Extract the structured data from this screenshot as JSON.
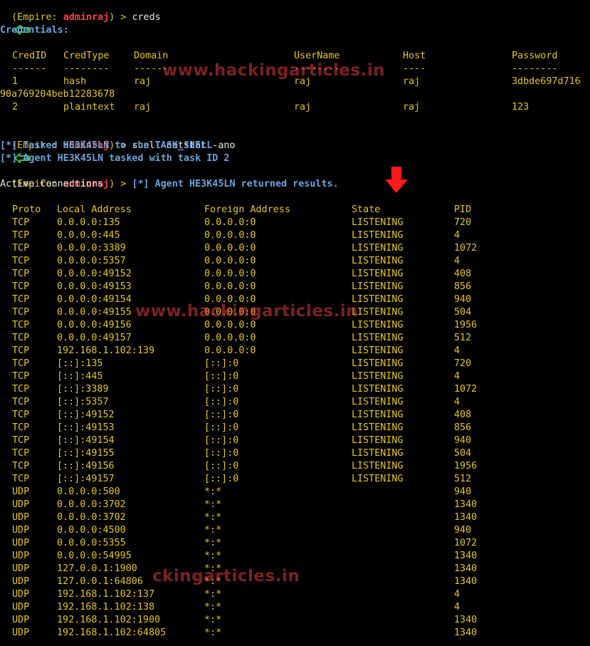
{
  "prompt": {
    "open": "(Empire: ",
    "user": "adminraj",
    "close": ") > "
  },
  "commands": {
    "creds": "creds",
    "shell": "shell netstat -ano"
  },
  "credentials": {
    "title": "Credentials:",
    "headers": [
      "CredID",
      "CredType",
      "Domain",
      "UserName",
      "Host",
      "Password"
    ],
    "separators": [
      "------",
      "--------",
      "------",
      "--------",
      "----",
      "--------"
    ],
    "rows": [
      {
        "id": "1",
        "type": "hash",
        "domain": "raj",
        "user": "raj",
        "host": "raj",
        "password": "3dbde697d716",
        "password_wrap": "90a769204beb12283678"
      },
      {
        "id": "2",
        "type": "plaintext",
        "domain": "raj",
        "user": "raj",
        "host": "raj",
        "password": "123"
      }
    ]
  },
  "messages": {
    "tasked": "[*] Tasked HE3K45LN to run TASK_SHELL",
    "task_id": "[*] Agent HE3K45LN tasked with task ID 2",
    "returned": "[*] Agent HE3K45LN returned results.",
    "active": "Active Connections"
  },
  "netstat": {
    "headers": [
      "Proto",
      "Local Address",
      "Foreign Address",
      "State",
      "PID"
    ],
    "rows": [
      [
        "TCP",
        "0.0.0.0:135",
        "0.0.0.0:0",
        "LISTENING",
        "720"
      ],
      [
        "TCP",
        "0.0.0.0:445",
        "0.0.0.0:0",
        "LISTENING",
        "4"
      ],
      [
        "TCP",
        "0.0.0.0:3389",
        "0.0.0.0:0",
        "LISTENING",
        "1072"
      ],
      [
        "TCP",
        "0.0.0.0:5357",
        "0.0.0.0:0",
        "LISTENING",
        "4"
      ],
      [
        "TCP",
        "0.0.0.0:49152",
        "0.0.0.0:0",
        "LISTENING",
        "408"
      ],
      [
        "TCP",
        "0.0.0.0:49153",
        "0.0.0.0:0",
        "LISTENING",
        "856"
      ],
      [
        "TCP",
        "0.0.0.0:49154",
        "0.0.0.0:0",
        "LISTENING",
        "940"
      ],
      [
        "TCP",
        "0.0.0.0:49155",
        "0.0.0.0:0",
        "LISTENING",
        "504"
      ],
      [
        "TCP",
        "0.0.0.0:49156",
        "0.0.0.0:0",
        "LISTENING",
        "1956"
      ],
      [
        "TCP",
        "0.0.0.0:49157",
        "0.0.0.0:0",
        "LISTENING",
        "512"
      ],
      [
        "TCP",
        "192.168.1.102:139",
        "0.0.0.0:0",
        "LISTENING",
        "4"
      ],
      [
        "TCP",
        "[::]:135",
        "[::]:0",
        "LISTENING",
        "720"
      ],
      [
        "TCP",
        "[::]:445",
        "[::]:0",
        "LISTENING",
        "4"
      ],
      [
        "TCP",
        "[::]:3389",
        "[::]:0",
        "LISTENING",
        "1072"
      ],
      [
        "TCP",
        "[::]:5357",
        "[::]:0",
        "LISTENING",
        "4"
      ],
      [
        "TCP",
        "[::]:49152",
        "[::]:0",
        "LISTENING",
        "408"
      ],
      [
        "TCP",
        "[::]:49153",
        "[::]:0",
        "LISTENING",
        "856"
      ],
      [
        "TCP",
        "[::]:49154",
        "[::]:0",
        "LISTENING",
        "940"
      ],
      [
        "TCP",
        "[::]:49155",
        "[::]:0",
        "LISTENING",
        "504"
      ],
      [
        "TCP",
        "[::]:49156",
        "[::]:0",
        "LISTENING",
        "1956"
      ],
      [
        "TCP",
        "[::]:49157",
        "[::]:0",
        "LISTENING",
        "512"
      ],
      [
        "UDP",
        "0.0.0.0:500",
        "*:*",
        "",
        "940"
      ],
      [
        "UDP",
        "0.0.0.0:3702",
        "*:*",
        "",
        "1340"
      ],
      [
        "UDP",
        "0.0.0.0:3702",
        "*:*",
        "",
        "1340"
      ],
      [
        "UDP",
        "0.0.0.0:4500",
        "*:*",
        "",
        "940"
      ],
      [
        "UDP",
        "0.0.0.0:5355",
        "*:*",
        "",
        "1072"
      ],
      [
        "UDP",
        "0.0.0.0:54995",
        "*:*",
        "",
        "1340"
      ],
      [
        "UDP",
        "127.0.0.1:1900",
        "*:*",
        "",
        "1340"
      ],
      [
        "UDP",
        "127.0.0.1:64806",
        "*:*",
        "",
        "1340"
      ],
      [
        "UDP",
        "192.168.1.102:137",
        "*:*",
        "",
        "4"
      ],
      [
        "UDP",
        "192.168.1.102:138",
        "*:*",
        "",
        "4"
      ],
      [
        "UDP",
        "192.168.1.102:1900",
        "*:*",
        "",
        "1340"
      ],
      [
        "UDP",
        "192.168.1.102:64805",
        "*:*",
        "",
        "1340"
      ]
    ]
  },
  "watermarks": [
    "www.hackingarticles.in",
    "www.hackingarticles.in",
    "ckingarticles.in"
  ],
  "colors": {
    "prompt_text": "#6aa4dc",
    "user": "#ff4040",
    "output": "#e6c619",
    "arrow_green": "#2fc22f",
    "arrow_red": "#ff1a1a"
  },
  "icons": {
    "annotation_arrow": "green-left-arrow-icon",
    "highlight_arrow": "red-down-arrow-icon"
  }
}
